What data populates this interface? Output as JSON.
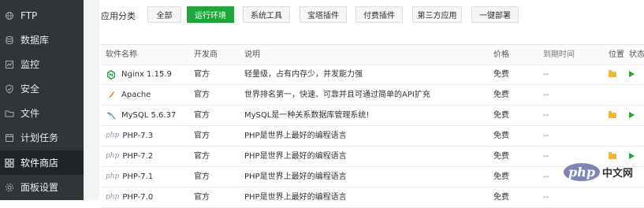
{
  "sidebar": {
    "items": [
      {
        "label": "FTP",
        "icon": "globe-icon",
        "active": false
      },
      {
        "label": "数据库",
        "icon": "database-icon",
        "active": false
      },
      {
        "label": "监控",
        "icon": "monitor-icon",
        "active": false
      },
      {
        "label": "安全",
        "icon": "shield-icon",
        "active": false
      },
      {
        "label": "文件",
        "icon": "folder-icon",
        "active": false
      },
      {
        "label": "计划任务",
        "icon": "calendar-icon",
        "active": false
      },
      {
        "label": "软件商店",
        "icon": "grid-icon",
        "active": true
      },
      {
        "label": "面板设置",
        "icon": "settings-icon",
        "active": false
      }
    ]
  },
  "categories": {
    "label": "应用分类",
    "buttons": [
      "全部",
      "运行环境",
      "系统工具",
      "宝塔插件",
      "付费插件",
      "第三方应用",
      "一键部署"
    ],
    "active": "运行环境"
  },
  "table": {
    "headers": {
      "name": "软件名称",
      "developer": "开发商",
      "description": "说明",
      "price": "价格",
      "expire": "到期时间",
      "location": "位置",
      "status": "状态"
    },
    "rows": [
      {
        "name": "Nginx 1.15.9",
        "icon": "nginx-icon",
        "developer": "官方",
        "description": "轻量级，占有内存少，并发能力强",
        "price": "免费",
        "expire": "--",
        "folder": true,
        "play": true
      },
      {
        "name": "Apache",
        "icon": "apache-feather-icon",
        "developer": "官方",
        "description": "世界排名第一，快速、可靠并且可通过简单的API扩充",
        "price": "免费",
        "expire": "--",
        "folder": false,
        "play": false
      },
      {
        "name": "MySQL 5.6.37",
        "icon": "mysql-dolphin-icon",
        "developer": "官方",
        "description": "MySQL是一种关系数据库管理系统!",
        "price": "免费",
        "expire": "--",
        "folder": true,
        "play": true
      },
      {
        "name": "PHP-7.3",
        "icon": "php-icon",
        "developer": "官方",
        "description": "PHP是世界上最好的编程语言",
        "price": "免费",
        "expire": "--",
        "folder": false,
        "play": false
      },
      {
        "name": "PHP-7.2",
        "icon": "php-icon",
        "developer": "官方",
        "description": "PHP是世界上最好的编程语言",
        "price": "免费",
        "expire": "--",
        "folder": true,
        "play": true
      },
      {
        "name": "PHP-7.1",
        "icon": "php-icon",
        "developer": "官方",
        "description": "PHP是世界上最好的编程语言",
        "price": "免费",
        "expire": "--",
        "folder": false,
        "play": false
      },
      {
        "name": "PHP-7.0",
        "icon": "php-icon",
        "developer": "官方",
        "description": "PHP是世界上最好的编程语言",
        "price": "免费",
        "expire": "--",
        "folder": false,
        "play": false
      }
    ]
  },
  "watermark": {
    "logo": "php",
    "text": "中文网"
  },
  "colors": {
    "accent": "#20a53a",
    "sidebar_bg": "#313538",
    "folder": "#f0b828",
    "php": "#8892bf"
  }
}
